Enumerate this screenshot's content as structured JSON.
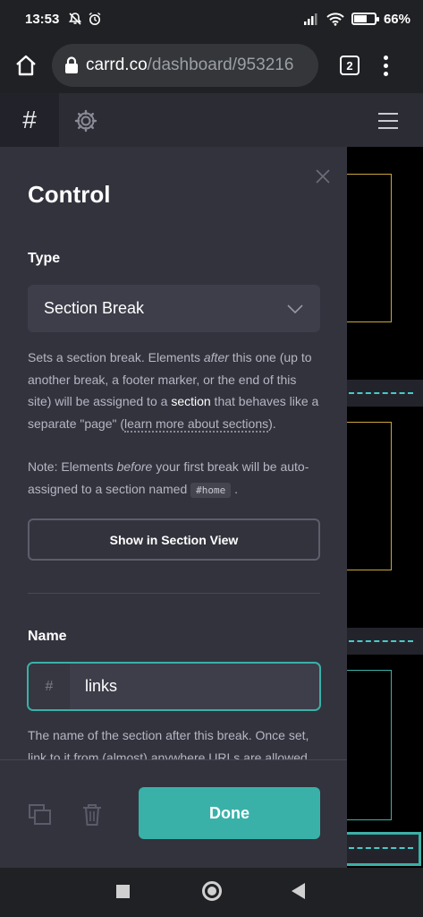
{
  "status_bar": {
    "time": "13:53",
    "battery": "66%",
    "battery_level": 0.66
  },
  "browser": {
    "url_host": "carrd.co",
    "url_path": "/dashboard/953216",
    "tab_count": "2"
  },
  "toolbar": {
    "icons": [
      "hash-icon",
      "gear-icon",
      "hamburger-menu-icon"
    ]
  },
  "panel": {
    "title": "Control",
    "type_label": "Type",
    "type_value": "Section Break",
    "description": {
      "p1_a": "Sets a section break. Elements ",
      "p1_em": "after",
      "p1_b": " this one (up to another break, a footer marker, or the end of this site) will be assigned to a ",
      "p1_hl": "section",
      "p1_c": " that behaves like a separate \"page\" (",
      "p1_link": "learn more about sections",
      "p1_d": ").",
      "p2_a": "Note: Elements ",
      "p2_em": "before",
      "p2_b": " your first break will be auto-assigned to a section named ",
      "p2_code": "#home",
      "p2_c": " ."
    },
    "section_view_button": "Show in Section View",
    "name_label": "Name",
    "name_prefix": "#",
    "name_value": "links",
    "name_help": "The name of the section after this break. Once set, link to it from (almost) anywhere URLs are allowed",
    "done_button": "Done"
  },
  "colors": {
    "accent": "#3ab1a8",
    "panel_bg": "#32333d",
    "toolbar_bg": "#2b2c34"
  }
}
